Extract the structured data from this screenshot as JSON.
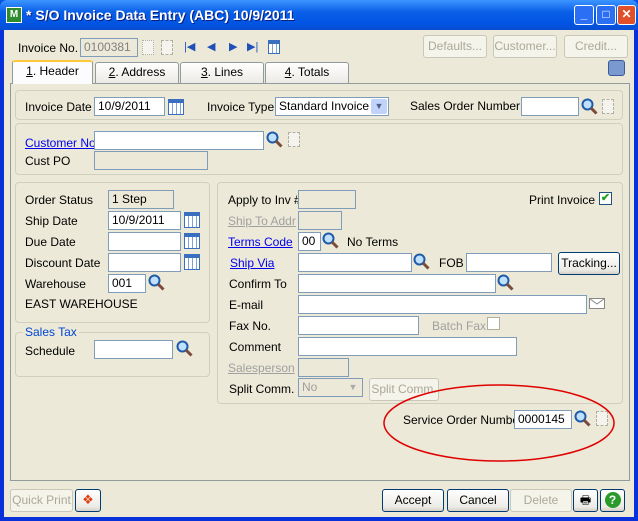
{
  "window": {
    "title": "* S/O Invoice Data Entry (ABC) 10/9/2011",
    "app_icon": "M"
  },
  "toolbar": {
    "invoice_no_label": "Invoice No.",
    "invoice_no": "0100381",
    "defaults": "Defaults...",
    "customer": "Customer...",
    "credit": "Credit..."
  },
  "tabs": [
    {
      "key": "1",
      "label": ". Header"
    },
    {
      "key": "2",
      "label": ". Address"
    },
    {
      "key": "3",
      "label": ". Lines"
    },
    {
      "key": "4",
      "label": ". Totals"
    }
  ],
  "header": {
    "invoice_date_label": "Invoice Date",
    "invoice_date": "10/9/2011",
    "invoice_type_label": "Invoice Type",
    "invoice_type": "Standard Invoice",
    "sales_order_label": "Sales Order Number",
    "sales_order": ""
  },
  "customer": {
    "customer_no_label": "Customer No.",
    "customer_no": "",
    "cust_po_label": "Cust PO",
    "cust_po": ""
  },
  "order": {
    "order_status_label": "Order Status",
    "order_status": "1 Step",
    "ship_date_label": "Ship Date",
    "ship_date": "10/9/2011",
    "due_date_label": "Due Date",
    "due_date": "",
    "discount_date_label": "Discount Date",
    "discount_date": "",
    "warehouse_label": "Warehouse",
    "warehouse": "001",
    "warehouse_name": "EAST WAREHOUSE"
  },
  "sales_tax": {
    "group_label": "Sales Tax",
    "schedule_label": "Schedule",
    "schedule": ""
  },
  "details": {
    "apply_label": "Apply to Inv #",
    "print_invoice_label": "Print Invoice",
    "print_invoice": true,
    "ship_to_label": "Ship To Addr",
    "terms_label": "Terms Code",
    "terms": "00",
    "terms_desc": "No Terms",
    "ship_via_label": "Ship Via",
    "fob_label": "FOB",
    "tracking": "Tracking...",
    "confirm_label": "Confirm To",
    "email_label": "E-mail",
    "fax_label": "Fax No.",
    "batch_fax_label": "Batch Fax",
    "batch_fax": false,
    "comment_label": "Comment",
    "salesperson_label": "Salesperson",
    "split_label": "Split Comm.",
    "split_value": "No",
    "split_button": "Split Comm."
  },
  "service": {
    "label": "Service Order Number",
    "value": "0000145",
    "highlight_color": "#E00000"
  },
  "footer": {
    "quick_print": "Quick Print",
    "accept": "Accept",
    "cancel": "Cancel",
    "delete": "Delete"
  }
}
